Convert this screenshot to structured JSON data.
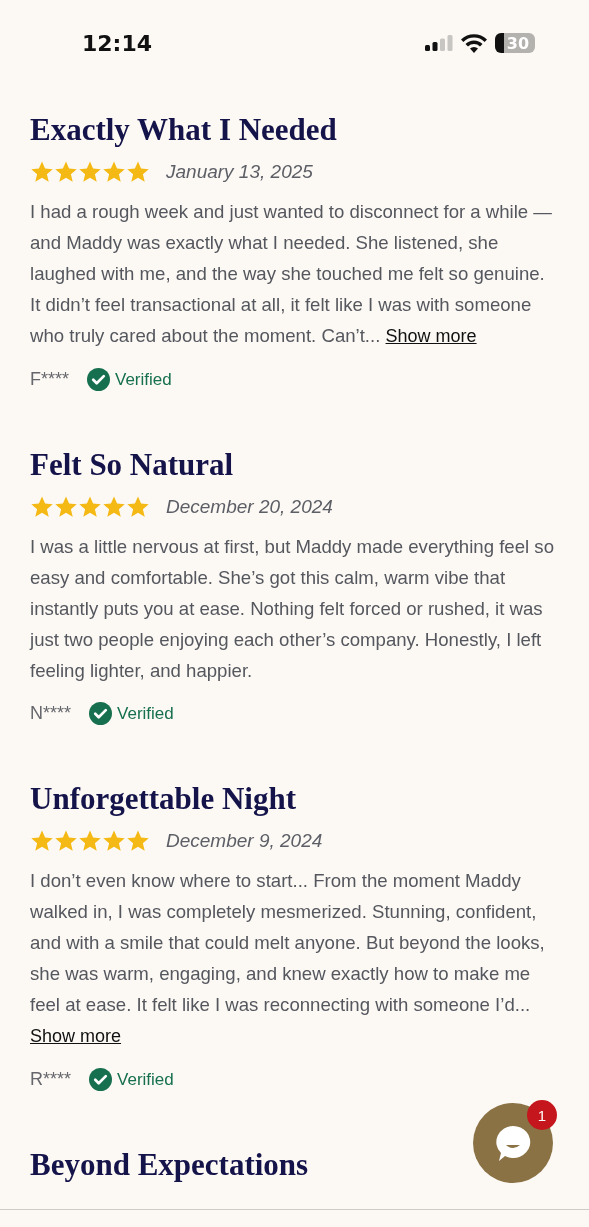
{
  "status_bar": {
    "time": "12:14",
    "battery": "30"
  },
  "reviews": [
    {
      "title": "Exactly What I Needed",
      "stars": 5,
      "date": "January 13, 2025",
      "text": "I had a rough week and just wanted to disconnect for a while —and Maddy was exactly what I needed. She listened, she laughed with me, and the way she touched me felt so genuine. It didn’t feel transactional at all, it felt like I was with someone who truly cared about the moment. Can’t...",
      "show_more": "Show more",
      "author": "F****",
      "verified": "Verified"
    },
    {
      "title": "Felt So Natural",
      "stars": 5,
      "date": "December 20, 2024",
      "text": "I was a little nervous at first, but Maddy made everything feel so easy and comfortable. She’s got this calm, warm vibe that instantly puts you at ease. Nothing felt forced or rushed, it was just two people enjoying each other’s company. Honestly, I left feeling lighter, and happier.",
      "author": "N****",
      "verified": "Verified"
    },
    {
      "title": "Unforgettable Night",
      "stars": 5,
      "date": "December 9, 2024",
      "text": "I don’t even know where to start... From the moment Maddy walked in, I was completely mesmerized. Stunning, confident, and with a smile that could melt anyone. But beyond the looks, she was warm, engaging, and knew exactly how to make me feel at ease. It felt like I was reconnecting with someone I’d...",
      "show_more": "Show more",
      "author": "R****",
      "verified": "Verified"
    },
    {
      "title": "Beyond Expectations"
    }
  ],
  "chat": {
    "badge": "1"
  }
}
